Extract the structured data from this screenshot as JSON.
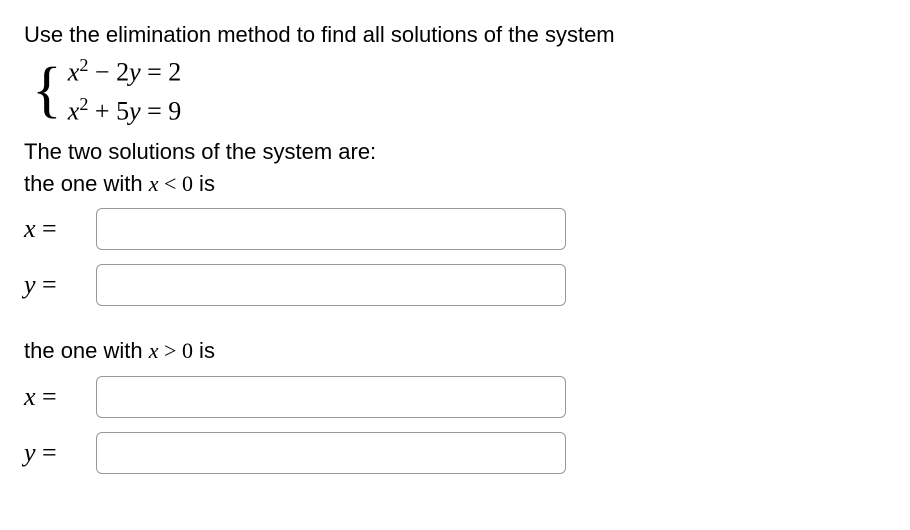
{
  "problem": {
    "instruction": "Use the elimination method to find all solutions of the system",
    "eq1_html": "<span class='math-inline'>x</span><sup>2</sup> <span class='n'>−</span> <span class='n'>2</span><span class='math-inline'>y</span> <span class='n'>=</span> <span class='n'>2</span>",
    "eq2_html": "<span class='math-inline'>x</span><sup>2</sup> <span class='n'>+</span> <span class='n'>5</span><span class='math-inline'>y</span> <span class='n'>=</span> <span class='n'>9</span>",
    "solution_intro": "The two solutions of the system are:",
    "neg_label_prefix": "the one with ",
    "neg_label_math": "x < 0",
    "neg_label_suffix": " is",
    "pos_label_prefix": "the one with ",
    "pos_label_math": "x > 0",
    "pos_label_suffix": " is",
    "x_eq": "x =",
    "y_eq": "y =",
    "inputs": {
      "neg_x": "",
      "neg_y": "",
      "pos_x": "",
      "pos_y": ""
    }
  },
  "chart_data": {
    "type": "table",
    "title": "System of equations",
    "equations": [
      {
        "lhs": "x^2 - 2y",
        "rhs": 2
      },
      {
        "lhs": "x^2 + 5y",
        "rhs": 9
      }
    ]
  }
}
